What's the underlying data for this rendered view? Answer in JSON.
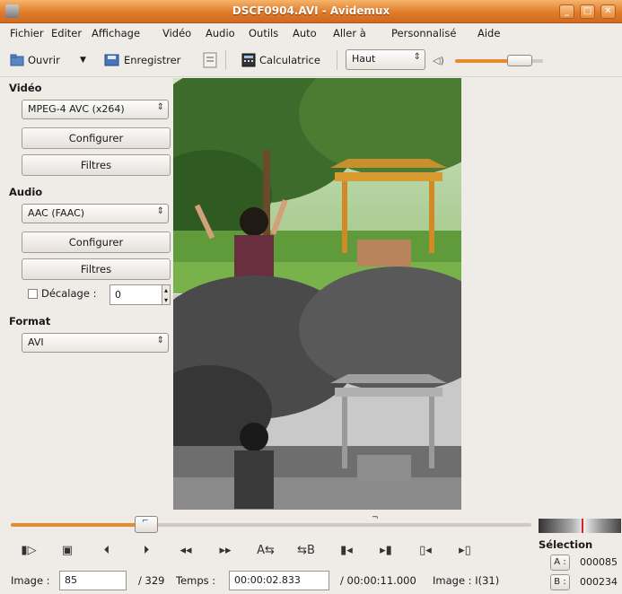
{
  "window": {
    "title": "DSCF0904.AVI - Avidemux"
  },
  "menu": [
    "Fichier",
    "Editer",
    "Affichage",
    "Vidéo",
    "Audio",
    "Outils",
    "Auto",
    "Aller à",
    "Personnalisé",
    "Aide"
  ],
  "toolbar": {
    "open_label": "Ouvrir",
    "save_label": "Enregistrer",
    "calc_label": "Calculatrice",
    "quality_value": "Haut",
    "volume_level": 0.8
  },
  "video": {
    "section_label": "Vidéo",
    "codec": "MPEG-4 AVC (x264)",
    "configure_label": "Configurer",
    "filters_label": "Filtres"
  },
  "audio": {
    "section_label": "Audio",
    "codec": "AAC (FAAC)",
    "configure_label": "Configurer",
    "filters_label": "Filtres",
    "shift_label": "Décalage :",
    "shift_value": "0"
  },
  "format": {
    "section_label": "Format",
    "value": "AVI"
  },
  "timeline": {
    "position_fraction": 0.26
  },
  "controls": {
    "marker_a_label": "A",
    "marker_b_label": "B"
  },
  "status": {
    "frame_label": "Image :",
    "frame_value": "85",
    "frame_total": "/ 329",
    "time_label": "Temps :",
    "time_value": "00:00:02.833",
    "duration": "/ 00:00:11.000",
    "frame_type": "Image : I(31)"
  },
  "selection": {
    "title": "Sélection",
    "a_label": "A :",
    "a_value": "000085",
    "b_label": "B :",
    "b_value": "000234"
  }
}
